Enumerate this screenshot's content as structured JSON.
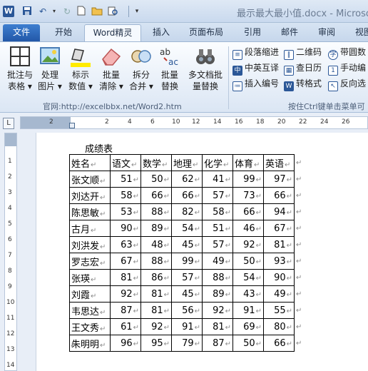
{
  "window": {
    "title": "最示最大最小值.docx - Microsoft"
  },
  "tabs": [
    "文件",
    "开始",
    "Word精灵",
    "插入",
    "页面布局",
    "引用",
    "邮件",
    "审阅",
    "视图"
  ],
  "ribbon": {
    "large_buttons": [
      {
        "line1": "批注与",
        "line2": "表格 ▾"
      },
      {
        "line1": "处理",
        "line2": "图片 ▾"
      },
      {
        "line1": "标示",
        "line2": "数值 ▾"
      },
      {
        "line1": "批量",
        "line2": "清除 ▾"
      },
      {
        "line1": "拆分",
        "line2": "合并 ▾"
      },
      {
        "line1": "批量",
        "line2": "替换"
      },
      {
        "line1": "多文档批",
        "line2": "量替换"
      }
    ],
    "small_buttons": [
      "段落缩进",
      "二维码",
      "带圆数",
      "中英互译",
      "查日历",
      "手动编",
      "插入编号",
      "转格式",
      "反向选"
    ],
    "group_label_left": "官网:http://excelbbx.net/Word2.htm",
    "group_label_right": "按住Ctrl键单击菜单可"
  },
  "ruler": {
    "h_numbers": [
      "2",
      "2",
      "4",
      "6",
      "8",
      "10",
      "12",
      "14",
      "16",
      "18",
      "20",
      "22",
      "24",
      "26",
      "28"
    ],
    "v_numbers": [
      "1",
      "2",
      "3",
      "4",
      "5",
      "6",
      "7",
      "8",
      "9",
      "10",
      "11",
      "12",
      "13",
      "14",
      "15",
      "16"
    ]
  },
  "document": {
    "caption": "成绩表",
    "headers": [
      "姓名",
      "语文",
      "数学",
      "地理",
      "化学",
      "体育",
      "英语"
    ],
    "rows": [
      [
        "张文顺",
        "51",
        "50",
        "62",
        "41",
        "99",
        "97"
      ],
      [
        "刘达开",
        "58",
        "66",
        "66",
        "57",
        "73",
        "66"
      ],
      [
        "陈思敏",
        "53",
        "88",
        "82",
        "58",
        "66",
        "94"
      ],
      [
        "古月",
        "90",
        "89",
        "54",
        "51",
        "46",
        "67"
      ],
      [
        "刘洪发",
        "63",
        "48",
        "45",
        "57",
        "92",
        "81"
      ],
      [
        "罗志宏",
        "67",
        "88",
        "99",
        "49",
        "50",
        "93"
      ],
      [
        "张瑛",
        "81",
        "86",
        "57",
        "88",
        "54",
        "90"
      ],
      [
        "刘霞",
        "92",
        "81",
        "45",
        "89",
        "43",
        "49"
      ],
      [
        "韦思达",
        "87",
        "81",
        "56",
        "92",
        "91",
        "55"
      ],
      [
        "王文秀",
        "61",
        "92",
        "91",
        "81",
        "69",
        "80"
      ],
      [
        "朱明明",
        "96",
        "95",
        "79",
        "87",
        "50",
        "66"
      ]
    ],
    "cell_mark": "↵",
    "paragraph_mark": "↵"
  }
}
